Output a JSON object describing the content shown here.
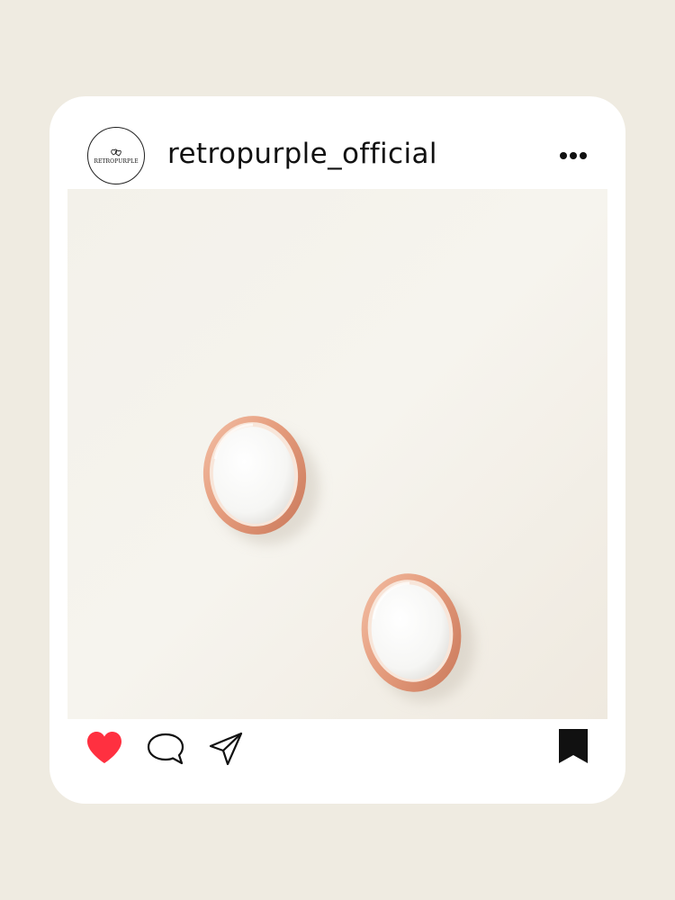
{
  "post": {
    "username": "retropurple_official",
    "avatar_text": "RETROPURPLE",
    "avatar_icon": "brand-logo-icon",
    "image_alt": "white oval stone earrings in rose gold setting",
    "colors": {
      "background": "#efebe1",
      "card": "#ffffff",
      "like": "#ff3040",
      "icon": "#111111",
      "gold": "#e8a384"
    },
    "actions": {
      "like_icon": "heart-icon",
      "comment_icon": "comment-icon",
      "share_icon": "paper-plane-icon",
      "save_icon": "bookmark-icon",
      "more_icon": "more-icon",
      "liked": true,
      "saved": true
    }
  }
}
